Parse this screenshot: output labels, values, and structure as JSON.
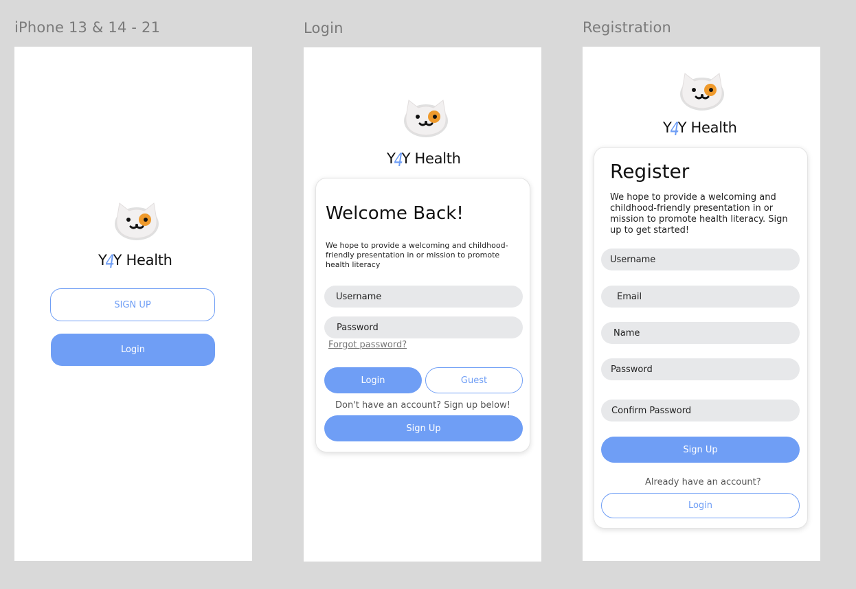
{
  "frames": {
    "splash": {
      "label": "iPhone 13 & 14 - 21"
    },
    "login": {
      "label": "Login"
    },
    "registration": {
      "label": "Registration"
    }
  },
  "brand": {
    "y_left": "Y",
    "four": "4",
    "y_right": "Y",
    "name": "Health"
  },
  "splash": {
    "signup_label": "SIGN UP",
    "login_label": "Login"
  },
  "login": {
    "title": "Welcome Back!",
    "description": "We hope to provide a welcoming and childhood-friendly presentation in or mission to promote health literacy",
    "username_placeholder": "Username",
    "password_placeholder": "Password",
    "forgot_password": "Forgot password?",
    "login_label": "Login",
    "guest_label": "Guest",
    "no_account_text": "Don't have an account? Sign up below!",
    "signup_label": "Sign Up"
  },
  "register": {
    "title": "Register",
    "description": "We hope to provide a welcoming and childhood-friendly presentation in or mission to promote health literacy. Sign up to get started!",
    "username_placeholder": "Username",
    "email_placeholder": "Email",
    "name_placeholder": "Name",
    "password_placeholder": "Password",
    "confirm_password_placeholder": "Confirm Password",
    "signup_label": "Sign Up",
    "have_account_text": "Already have an account?",
    "login_label": "Login"
  },
  "colors": {
    "background": "#d9d9d9",
    "accent": "#6f9ef5",
    "field": "#e7e8ea",
    "cat_patch": "#ef9a2c"
  }
}
